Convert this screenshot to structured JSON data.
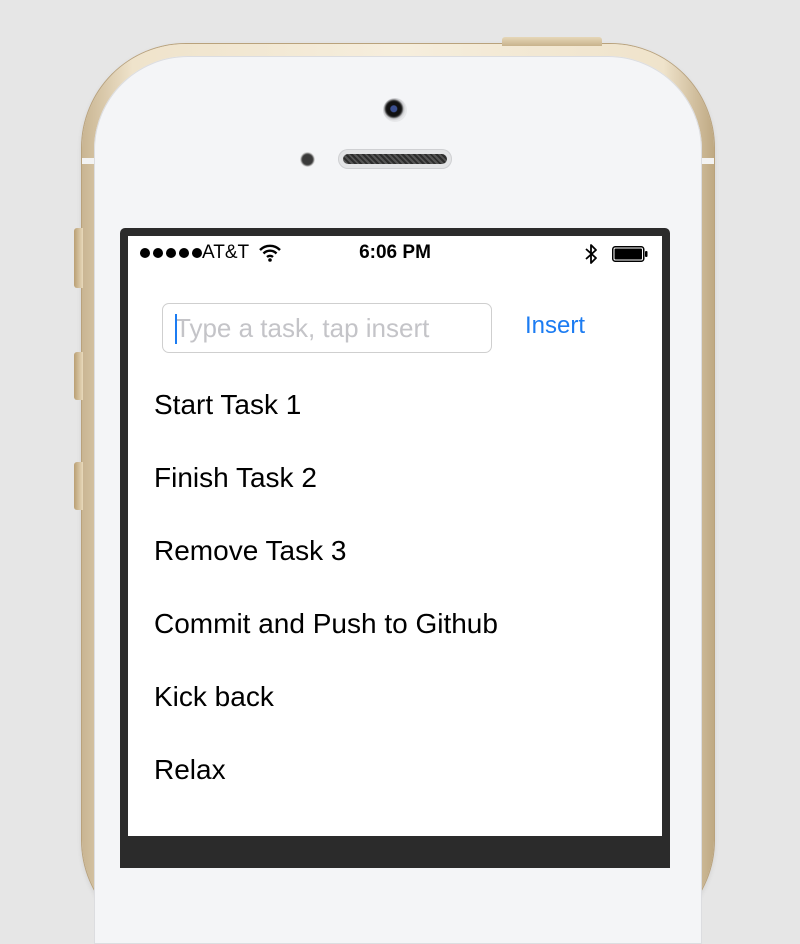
{
  "status_bar": {
    "carrier": "AT&T",
    "time": "6:06 PM",
    "signal_bars": 5,
    "icons": [
      "signal-dots-icon",
      "wifi-icon",
      "bluetooth-icon",
      "battery-icon"
    ]
  },
  "form": {
    "input_value": "",
    "input_placeholder": "Type a task, tap insert",
    "insert_label": "Insert"
  },
  "tasks": [
    "Start Task 1",
    "Finish Task 2",
    "Remove Task 3",
    "Commit and Push to Github",
    "Kick back",
    "Relax"
  ],
  "colors": {
    "accent": "#1c7cf2",
    "background": "#e6e6e6",
    "bezel": "#2b2b2b"
  }
}
